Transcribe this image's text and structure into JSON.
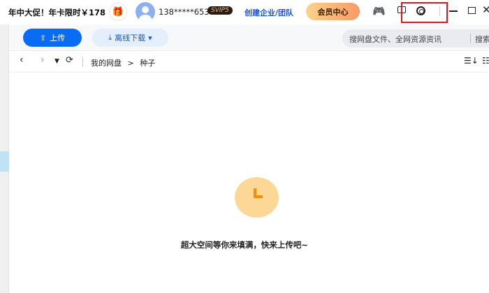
{
  "topbar": {
    "promo": "年中大促！年卡限时￥178",
    "phone": "138*****653",
    "vip_badge": "SVIP5",
    "enterprise_link": "创建企业/团队",
    "member_center": "会员中心"
  },
  "toolbar": {
    "upload_label": "上传",
    "offline_download_label": "离线下载",
    "search_placeholder": "搜网盘文件、全网资源资讯",
    "search_button": "搜索"
  },
  "breadcrumb": {
    "root": "我的网盘",
    "separator": ">",
    "current": "种子"
  },
  "empty_state": {
    "message": "超大空间等你来填满，快来上传吧~"
  },
  "colors": {
    "accent": "#0a6cf5",
    "highlight_box": "#e0141e"
  }
}
